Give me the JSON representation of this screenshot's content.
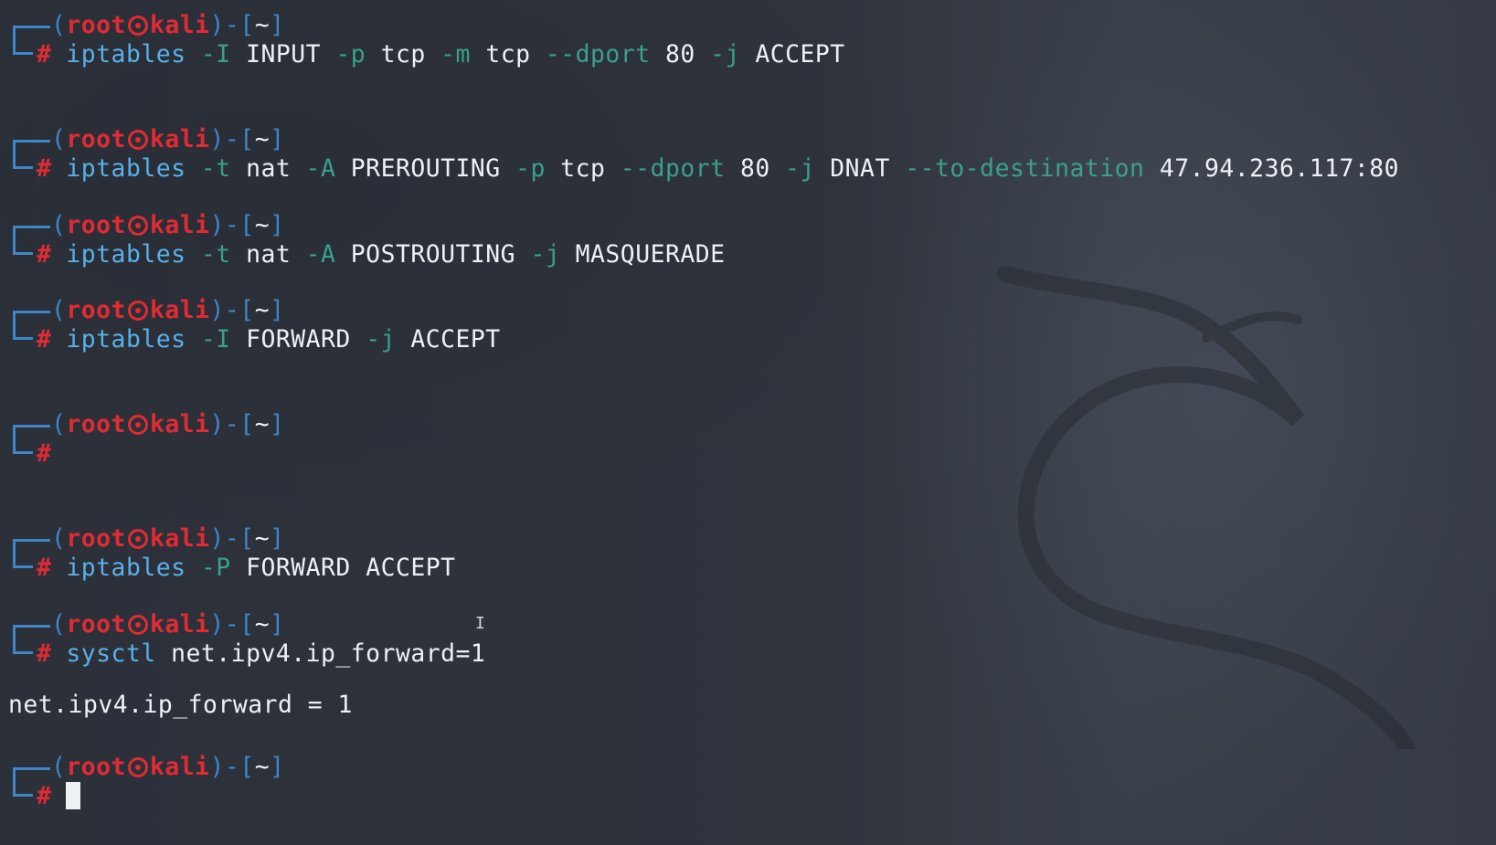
{
  "prompt": {
    "user": "root",
    "host": "kali",
    "dir": "~",
    "symbol": "#",
    "separator_icon": "skull-icon"
  },
  "blocks": [
    {
      "command_tokens": [
        {
          "text": "iptables",
          "kind": "cmd"
        },
        {
          "text": "-I",
          "kind": "flag"
        },
        {
          "text": "INPUT",
          "kind": "arg"
        },
        {
          "text": "-p",
          "kind": "flag"
        },
        {
          "text": "tcp",
          "kind": "arg"
        },
        {
          "text": "-m",
          "kind": "flag"
        },
        {
          "text": "tcp",
          "kind": "arg"
        },
        {
          "text": "--dport",
          "kind": "flag"
        },
        {
          "text": "80",
          "kind": "arg"
        },
        {
          "text": "-j",
          "kind": "flag"
        },
        {
          "text": "ACCEPT",
          "kind": "arg"
        }
      ]
    },
    {
      "command_tokens": [
        {
          "text": "iptables",
          "kind": "cmd"
        },
        {
          "text": "-t",
          "kind": "flag"
        },
        {
          "text": "nat",
          "kind": "arg"
        },
        {
          "text": "-A",
          "kind": "flag"
        },
        {
          "text": "PREROUTING",
          "kind": "arg"
        },
        {
          "text": "-p",
          "kind": "flag"
        },
        {
          "text": "tcp",
          "kind": "arg"
        },
        {
          "text": "--dport",
          "kind": "flag"
        },
        {
          "text": "80",
          "kind": "arg"
        },
        {
          "text": "-j",
          "kind": "flag"
        },
        {
          "text": "DNAT",
          "kind": "arg"
        },
        {
          "text": "--to-destination",
          "kind": "flag"
        },
        {
          "text": "47.94.236.117:80",
          "kind": "arg"
        }
      ]
    },
    {
      "command_tokens": [
        {
          "text": "iptables",
          "kind": "cmd"
        },
        {
          "text": "-t",
          "kind": "flag"
        },
        {
          "text": "nat",
          "kind": "arg"
        },
        {
          "text": "-A",
          "kind": "flag"
        },
        {
          "text": "POSTROUTING",
          "kind": "arg"
        },
        {
          "text": "-j",
          "kind": "flag"
        },
        {
          "text": "MASQUERADE",
          "kind": "arg"
        }
      ]
    },
    {
      "command_tokens": [
        {
          "text": "iptables",
          "kind": "cmd"
        },
        {
          "text": "-I",
          "kind": "flag"
        },
        {
          "text": "FORWARD",
          "kind": "arg"
        },
        {
          "text": "-j",
          "kind": "flag"
        },
        {
          "text": "ACCEPT",
          "kind": "arg"
        }
      ]
    },
    {
      "command_tokens": []
    },
    {
      "command_tokens": [
        {
          "text": "iptables",
          "kind": "cmd"
        },
        {
          "text": "-P",
          "kind": "flag"
        },
        {
          "text": "FORWARD",
          "kind": "arg"
        },
        {
          "text": "ACCEPT",
          "kind": "arg"
        }
      ]
    },
    {
      "command_tokens": [
        {
          "text": "sysctl",
          "kind": "cmd"
        },
        {
          "text": "net.ipv4.ip_forward=1",
          "kind": "arg"
        }
      ]
    },
    {
      "command_tokens": [],
      "cursor": true
    }
  ],
  "output": {
    "text": "net.ipv4.ip_forward = 1"
  },
  "colors": {
    "background": "#2c3039",
    "prompt_bracket": "#3e86c8",
    "prompt_user_host": "#e02b34",
    "command": "#58b0e8",
    "flag": "#3aa08c",
    "argument": "#eef0f4"
  },
  "icons": {
    "background_logo": "kali-dragon-icon",
    "mouse_pointer": "text-cursor-icon"
  }
}
